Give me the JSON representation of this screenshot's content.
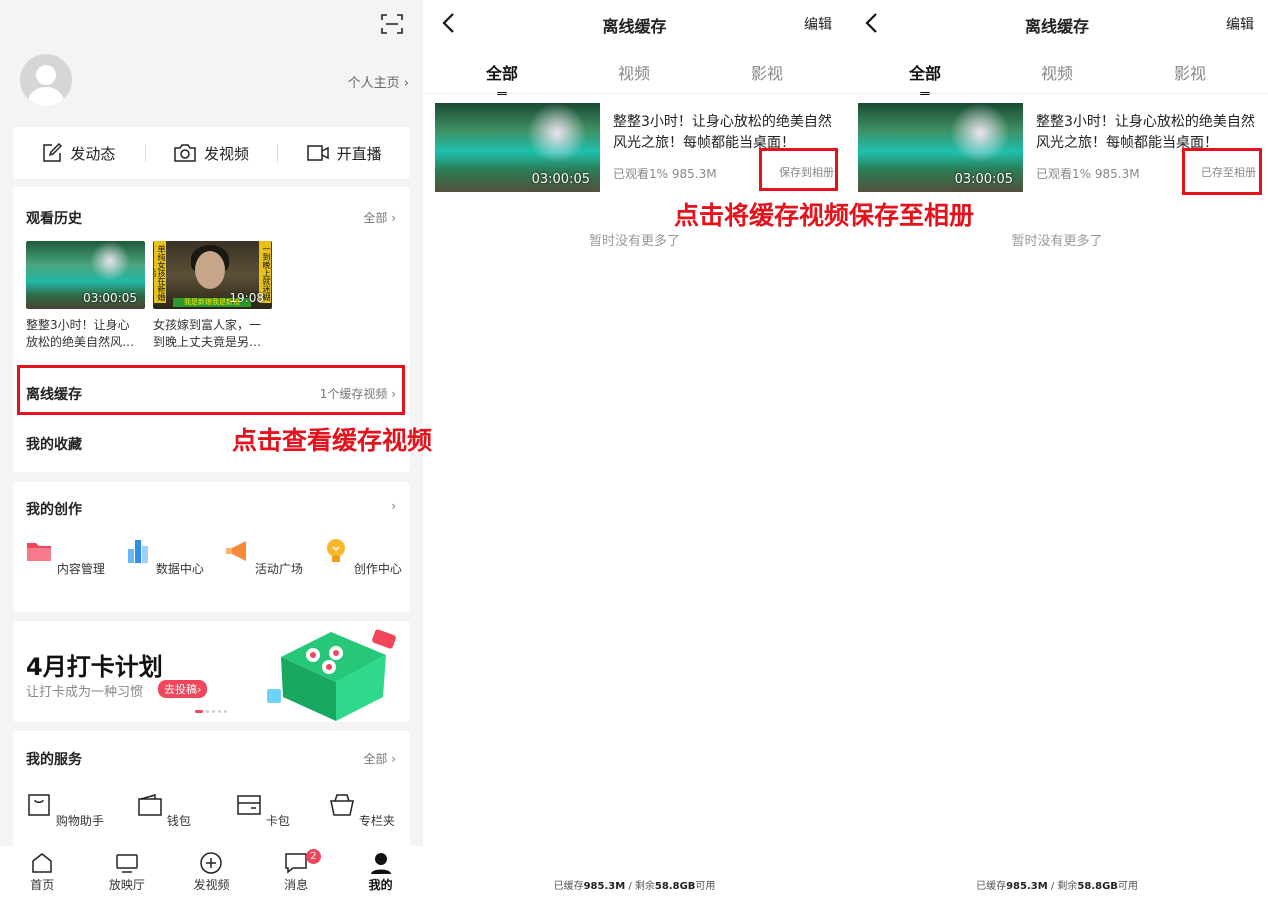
{
  "profile": {
    "home_link": "个人主页 ›"
  },
  "quick_actions": [
    {
      "label": "发动态"
    },
    {
      "label": "发视频"
    },
    {
      "label": "开直播"
    }
  ],
  "history": {
    "title": "观看历史",
    "all": "全部 ›",
    "items": [
      {
        "duration": "03:00:05",
        "caption_line1": "整整3小时！让身心",
        "caption_line2": "放松的绝美自然风…"
      },
      {
        "duration": "19:08",
        "caption_line1": "女孩嫁到富人家，一",
        "caption_line2": "到晚上丈夫竟是另…",
        "overlay_side": "单纯女孩在新婚后",
        "overlay_right": "一到晚上就迷糊",
        "overlay_bottom": "我是新娘我是新娘"
      }
    ]
  },
  "offline": {
    "label": "离线缓存",
    "count": "1个缓存视频 ›"
  },
  "favorites": {
    "label": "我的收藏"
  },
  "annotation_left": "点击查看缓存视频",
  "annotation_right": "点击将缓存视频保存至相册",
  "creation": {
    "title": "我的创作",
    "arrow": "›",
    "items": [
      {
        "label": "内容管理"
      },
      {
        "label": "数据中心"
      },
      {
        "label": "活动广场"
      },
      {
        "label": "创作中心"
      }
    ]
  },
  "banner": {
    "title": "4月打卡计划",
    "subtitle": "让打卡成为一种习惯",
    "button": "去投稿›"
  },
  "services": {
    "title": "我的服务",
    "all": "全部 ›",
    "items": [
      {
        "label": "购物助手"
      },
      {
        "label": "钱包"
      },
      {
        "label": "卡包"
      },
      {
        "label": "专栏夹"
      }
    ]
  },
  "tabbar": {
    "items": [
      {
        "label": "首页"
      },
      {
        "label": "放映厅"
      },
      {
        "label": "发视频"
      },
      {
        "label": "消息"
      },
      {
        "label": "我的"
      }
    ],
    "message_badge": "2"
  },
  "cache_page": {
    "title": "离线缓存",
    "edit": "编辑",
    "tabs": [
      {
        "label": "全部"
      },
      {
        "label": "视频"
      },
      {
        "label": "影视"
      }
    ],
    "video": {
      "title": "整整3小时！让身心放松的绝美自然风光之旅！每帧都能当桌面！",
      "duration": "03:00:05",
      "watched": "已观看1%",
      "size": "985.3M"
    },
    "save_before": "保存到相册",
    "save_after": "已存至相册",
    "no_more": "暂时没有更多了",
    "storage_prefix": "已缓存",
    "storage_used": "985.3M",
    "storage_mid": " / 剩余",
    "storage_free": "58.8GB",
    "storage_suffix": "可用"
  },
  "colors": {
    "accent": "#e5121b",
    "brand_pink": "#f0455a"
  }
}
